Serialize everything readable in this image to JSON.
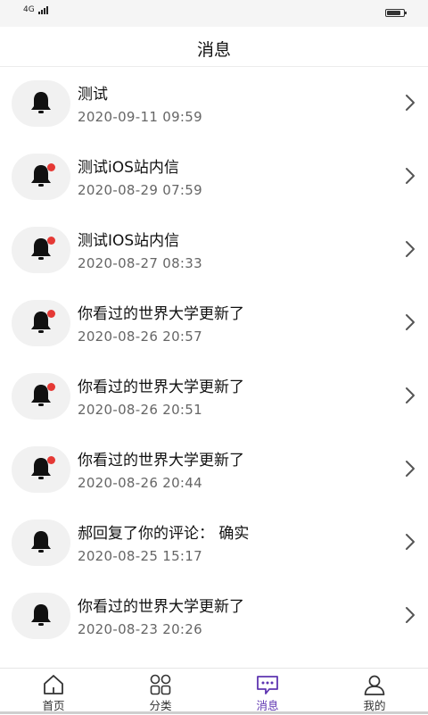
{
  "status": {
    "network": "4G",
    "battery_level": 0.85
  },
  "header": {
    "title": "消息"
  },
  "messages": [
    {
      "title": "测试",
      "time": "2020-09-11 09:59",
      "unread": false
    },
    {
      "title": "测试iOS站内信",
      "time": "2020-08-29 07:59",
      "unread": true
    },
    {
      "title": "测试IOS站内信",
      "time": "2020-08-27 08:33",
      "unread": true
    },
    {
      "title": "你看过的世界大学更新了",
      "time": "2020-08-26 20:57",
      "unread": true
    },
    {
      "title": "你看过的世界大学更新了",
      "time": "2020-08-26 20:51",
      "unread": true
    },
    {
      "title": "你看过的世界大学更新了",
      "time": "2020-08-26 20:44",
      "unread": true
    },
    {
      "title": "郝回复了你的评论： 确实",
      "time": "2020-08-25 15:17",
      "unread": false
    },
    {
      "title": "你看过的世界大学更新了",
      "time": "2020-08-23 20:26",
      "unread": false
    }
  ],
  "tabbar": {
    "active": "messages",
    "items": [
      {
        "key": "home",
        "label": "首页",
        "icon": "home-icon"
      },
      {
        "key": "category",
        "label": "分类",
        "icon": "grid-icon"
      },
      {
        "key": "messages",
        "label": "消息",
        "icon": "chat-icon"
      },
      {
        "key": "profile",
        "label": "我的",
        "icon": "user-icon"
      }
    ]
  },
  "colors": {
    "accent": "#5e35b1",
    "badge": "#e53935",
    "icon_bg": "#f1f1f1"
  }
}
